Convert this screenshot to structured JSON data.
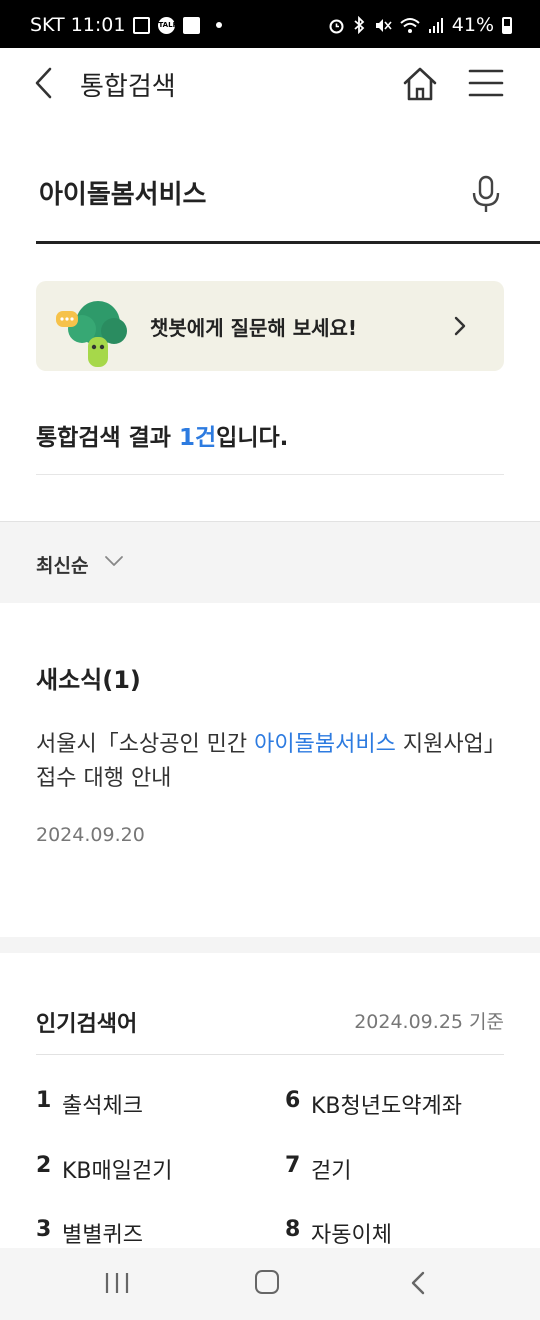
{
  "status_bar": {
    "carrier_time": "SKT 11:01",
    "talk_icon_text": "TALK",
    "battery": "41%",
    "icons": [
      "image-icon",
      "talk-icon",
      "flag-icon",
      "alarm-icon",
      "bluetooth-icon",
      "mute-icon",
      "wifi-icon",
      "signal-icon",
      "battery-icon"
    ]
  },
  "header": {
    "title": "통합검색",
    "icons": [
      "back-chevron-icon",
      "home-icon",
      "hamburger-menu-icon"
    ]
  },
  "search": {
    "value": "아이돌봄서비스",
    "icon": "microphone-icon"
  },
  "chatbot": {
    "text": "챗봇에게 질문해 보세요!",
    "icon": "chevron-right-icon"
  },
  "results": {
    "prefix": "통합검색 결과 ",
    "count": "1건",
    "suffix": "입니다."
  },
  "sort": {
    "label": "최신순",
    "icon": "chevron-down-icon"
  },
  "news": {
    "heading": "새소식(1)",
    "title_before": "서울시「소상공인 민간 ",
    "title_highlight": "아이돌봄서비스",
    "title_after": " 지원사업」 접수 대행 안내",
    "date": "2024.09.20"
  },
  "popular": {
    "heading": "인기검색어",
    "date": "2024.09.25 기준",
    "items": [
      {
        "rank": "1",
        "term": "출석체크"
      },
      {
        "rank": "2",
        "term": "KB매일걷기"
      },
      {
        "rank": "3",
        "term": "별별퀴즈"
      },
      {
        "rank": "6",
        "term": "KB청년도약계좌"
      },
      {
        "rank": "7",
        "term": "걷기"
      },
      {
        "rank": "8",
        "term": "자동이체"
      }
    ]
  },
  "nav_bar": {
    "icons": [
      "recent-apps-icon",
      "home-button-icon",
      "back-button-icon"
    ]
  },
  "colors": {
    "accent": "#2d7be0",
    "chatbot_bg": "#f2f1e6",
    "section_bg": "#f4f4f4"
  }
}
